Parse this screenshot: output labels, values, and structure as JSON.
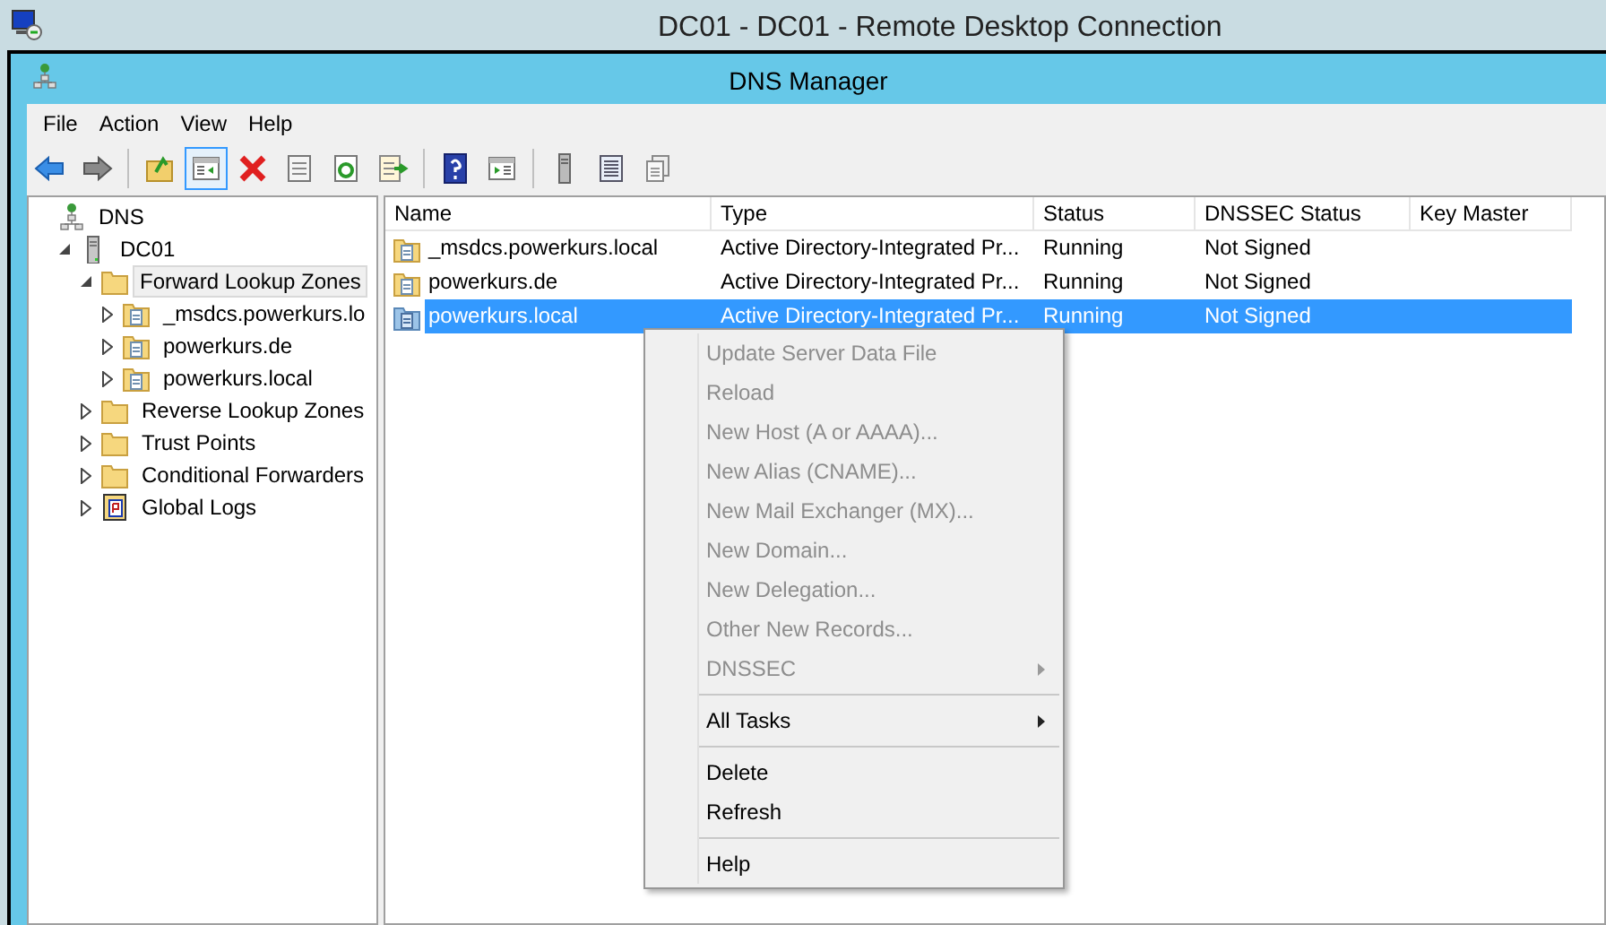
{
  "rdp_title": "DC01 - DC01 - Remote Desktop Connection",
  "window": {
    "title": "DNS Manager"
  },
  "menu_bar": [
    "File",
    "Action",
    "View",
    "Help"
  ],
  "toolbar": [
    {
      "kind": "back",
      "pressed": false
    },
    {
      "kind": "forward",
      "pressed": false
    },
    {
      "kind": "sep"
    },
    {
      "kind": "up",
      "pressed": false
    },
    {
      "kind": "tree",
      "pressed": true
    },
    {
      "kind": "delete",
      "pressed": false
    },
    {
      "kind": "properties",
      "pressed": false
    },
    {
      "kind": "refresh",
      "pressed": false
    },
    {
      "kind": "export",
      "pressed": false
    },
    {
      "kind": "sep"
    },
    {
      "kind": "help",
      "pressed": false
    },
    {
      "kind": "action_pane",
      "pressed": false
    },
    {
      "kind": "sep"
    },
    {
      "kind": "server",
      "pressed": false
    },
    {
      "kind": "list",
      "pressed": false
    },
    {
      "kind": "copy",
      "pressed": false
    }
  ],
  "tree": [
    {
      "label": "DNS",
      "kind": "dns",
      "selected": false,
      "children": [
        {
          "label": "DC01",
          "kind": "server",
          "selected": false,
          "expanded": true,
          "children": [
            {
              "label": "Forward Lookup Zones",
              "kind": "folder",
              "selected": true,
              "expanded": true,
              "children": [
                {
                  "label": "_msdcs.powerkurs.lo",
                  "kind": "zone",
                  "selected": false,
                  "expanded": false
                },
                {
                  "label": "powerkurs.de",
                  "kind": "zone",
                  "selected": false,
                  "expanded": false
                },
                {
                  "label": "powerkurs.local",
                  "kind": "zone",
                  "selected": false,
                  "expanded": false
                }
              ]
            },
            {
              "label": "Reverse Lookup Zones",
              "kind": "folder",
              "selected": false,
              "expanded": false
            },
            {
              "label": "Trust Points",
              "kind": "folder",
              "selected": false,
              "expanded": false
            },
            {
              "label": "Conditional Forwarders",
              "kind": "folder",
              "selected": false,
              "expanded": false
            },
            {
              "label": "Global Logs",
              "kind": "log",
              "selected": false,
              "expanded": false
            }
          ]
        }
      ]
    }
  ],
  "table": {
    "columns": [
      "Name",
      "Type",
      "Status",
      "DNSSEC Status",
      "Key Master"
    ],
    "rows": [
      {
        "name": "_msdcs.powerkurs.local",
        "type": "Active Directory-Integrated Pr...",
        "status": "Running",
        "dnssec": "Not Signed",
        "selected": false
      },
      {
        "name": "powerkurs.de",
        "type": "Active Directory-Integrated Pr...",
        "status": "Running",
        "dnssec": "Not Signed",
        "selected": false
      },
      {
        "name": "powerkurs.local",
        "type": "Active Directory-Integrated Pr...",
        "status": "Running",
        "dnssec": "Not Signed",
        "selected": true
      }
    ]
  },
  "context_menu": [
    {
      "kind": "item",
      "label": "Update Server Data File",
      "disabled": true,
      "submenu": false
    },
    {
      "kind": "item",
      "label": "Reload",
      "disabled": true,
      "submenu": false
    },
    {
      "kind": "item",
      "label": "New Host (A or AAAA)...",
      "disabled": true,
      "submenu": false
    },
    {
      "kind": "item",
      "label": "New Alias (CNAME)...",
      "disabled": true,
      "submenu": false
    },
    {
      "kind": "item",
      "label": "New Mail Exchanger (MX)...",
      "disabled": true,
      "submenu": false
    },
    {
      "kind": "item",
      "label": "New Domain...",
      "disabled": true,
      "submenu": false
    },
    {
      "kind": "item",
      "label": "New Delegation...",
      "disabled": true,
      "submenu": false
    },
    {
      "kind": "item",
      "label": "Other New Records...",
      "disabled": true,
      "submenu": false
    },
    {
      "kind": "item",
      "label": "DNSSEC",
      "disabled": true,
      "submenu": true
    },
    {
      "kind": "separator"
    },
    {
      "kind": "item",
      "label": "All Tasks",
      "disabled": false,
      "submenu": true
    },
    {
      "kind": "separator"
    },
    {
      "kind": "item",
      "label": "Delete",
      "disabled": false,
      "submenu": false
    },
    {
      "kind": "item",
      "label": "Refresh",
      "disabled": false,
      "submenu": false
    },
    {
      "kind": "separator"
    },
    {
      "kind": "item",
      "label": "Help",
      "disabled": false,
      "submenu": false
    }
  ]
}
